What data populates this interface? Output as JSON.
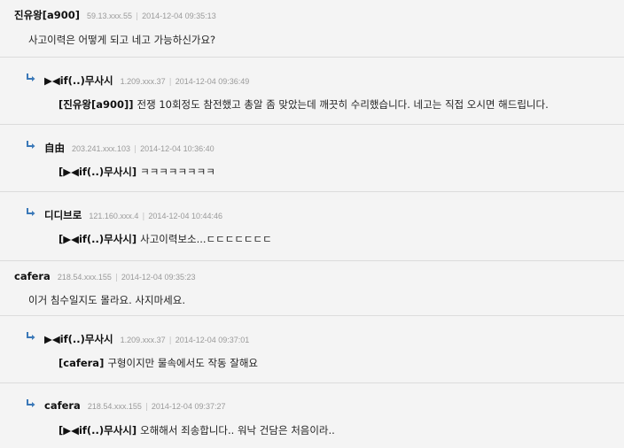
{
  "comments": [
    {
      "author": "진유왕[a900]",
      "ip": "59.13.xxx.55",
      "date": "2014-12-04 09:35:13",
      "reply": false,
      "tag": "",
      "text": "사고이력은 어떻게 되고 네고 가능하신가요?"
    },
    {
      "author": "▶◀if(..)무사시",
      "ip": "1.209.xxx.37",
      "date": "2014-12-04 09:36:49",
      "reply": true,
      "tag": "[진유왕[a900]]",
      "text": "전쟁 10회정도 참전했고 총알 좀 맞았는데 깨끗히 수리했습니다. 네고는 직접 오시면 해드립니다."
    },
    {
      "author": "自由",
      "ip": "203.241.xxx.103",
      "date": "2014-12-04 10:36:40",
      "reply": true,
      "tag": "[▶◀if(..)무사시]",
      "text": "ㅋㅋㅋㅋㅋㅋㅋㅋ"
    },
    {
      "author": "디디브로",
      "ip": "121.160.xxx.4",
      "date": "2014-12-04 10:44:46",
      "reply": true,
      "tag": "[▶◀if(..)무사시]",
      "text": "사고이력보소...ㄷㄷㄷㄷㄷㄷㄷ"
    },
    {
      "author": "cafera",
      "ip": "218.54.xxx.155",
      "date": "2014-12-04 09:35:23",
      "reply": false,
      "tag": "",
      "text": "이거 침수일지도 몰라요. 사지마세요."
    },
    {
      "author": "▶◀if(..)무사시",
      "ip": "1.209.xxx.37",
      "date": "2014-12-04 09:37:01",
      "reply": true,
      "tag": "[cafera]",
      "text": "구형이지만 물속에서도 작동 잘해요"
    },
    {
      "author": "cafera",
      "ip": "218.54.xxx.155",
      "date": "2014-12-04 09:37:27",
      "reply": true,
      "tag": "[▶◀if(..)무사시]",
      "text": "오해해서 죄송합니다.. 워낙 건담은 처음이라.."
    }
  ]
}
